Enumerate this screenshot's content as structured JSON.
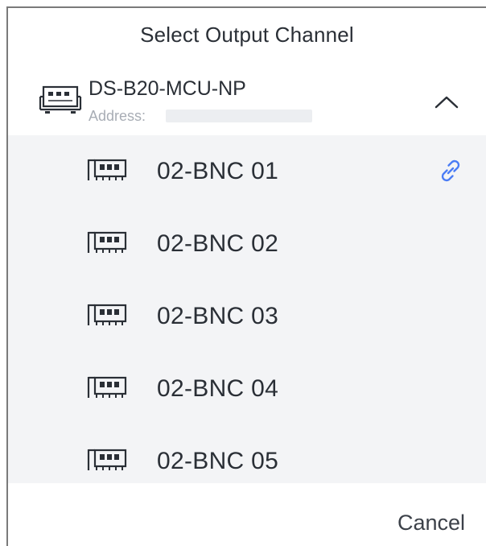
{
  "dialog": {
    "title": "Select Output Channel",
    "cancel_label": "Cancel"
  },
  "device": {
    "name": "DS-B20-MCU-NP",
    "address_label": "Address:",
    "icon": "device-icon",
    "expanded": true
  },
  "channels": [
    {
      "label": "02-BNC 01",
      "linked": true
    },
    {
      "label": "02-BNC 02",
      "linked": false
    },
    {
      "label": "02-BNC 03",
      "linked": false
    },
    {
      "label": "02-BNC 04",
      "linked": false
    },
    {
      "label": "02-BNC 05",
      "linked": false
    }
  ],
  "colors": {
    "text": "#2a2f36",
    "muted": "#a8adb5",
    "list_bg": "#f3f4f6",
    "link_accent": "#4a7cf5"
  }
}
